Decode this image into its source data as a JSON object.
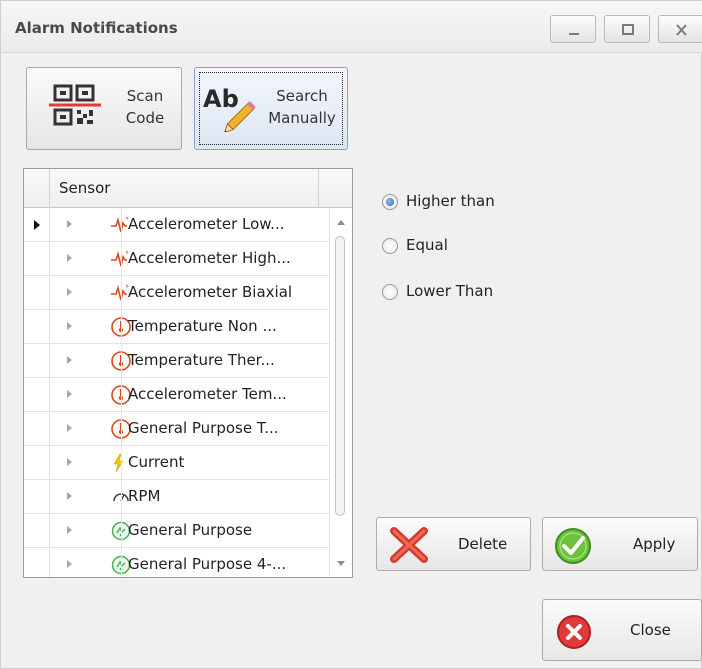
{
  "window": {
    "title": "Alarm Notifications",
    "controls": [
      "minimize",
      "maximize",
      "close"
    ]
  },
  "toolbar": {
    "scan_code": {
      "line1": "Scan",
      "line2": "Code",
      "icon": "qr-code-icon"
    },
    "search_manually": {
      "line1": "Search",
      "line2": "Manually",
      "icon": "ab-pencil-icon",
      "icon_text": "Ab"
    }
  },
  "sensor_grid": {
    "header": "Sensor",
    "rows": [
      {
        "label": "Accelerometer Low...",
        "icon": "accelerometer-icon"
      },
      {
        "label": "Accelerometer High...",
        "icon": "accelerometer-icon"
      },
      {
        "label": "Accelerometer Biaxial",
        "icon": "accelerometer-icon"
      },
      {
        "label": "Temperature Non ...",
        "icon": "thermometer-icon"
      },
      {
        "label": "Temperature Ther...",
        "icon": "thermometer-icon"
      },
      {
        "label": "Accelerometer Tem...",
        "icon": "thermometer-icon"
      },
      {
        "label": "General Purpose T...",
        "icon": "thermometer-icon"
      },
      {
        "label": "Current",
        "icon": "lightning-icon"
      },
      {
        "label": "RPM",
        "icon": "gauge-icon"
      },
      {
        "label": "General Purpose",
        "icon": "general-purpose-icon"
      },
      {
        "label": "General Purpose 4-...",
        "icon": "general-purpose-icon"
      }
    ],
    "focused_row_index": 0
  },
  "comparison": {
    "options": [
      {
        "label": "Higher than",
        "checked": true
      },
      {
        "label": "Equal",
        "checked": false
      },
      {
        "label": "Lower Than",
        "checked": false
      }
    ]
  },
  "actions": {
    "delete_label": "Delete",
    "apply_label": "Apply",
    "close_label": "Close"
  },
  "colors": {
    "sensor_icon_red": "#d9481f",
    "bolt_yellow": "#f5c400",
    "general_green": "#4caf50",
    "apply_green": "#6cc23a",
    "close_red": "#e03a3a",
    "radio_blue": "#2f6fc4"
  }
}
